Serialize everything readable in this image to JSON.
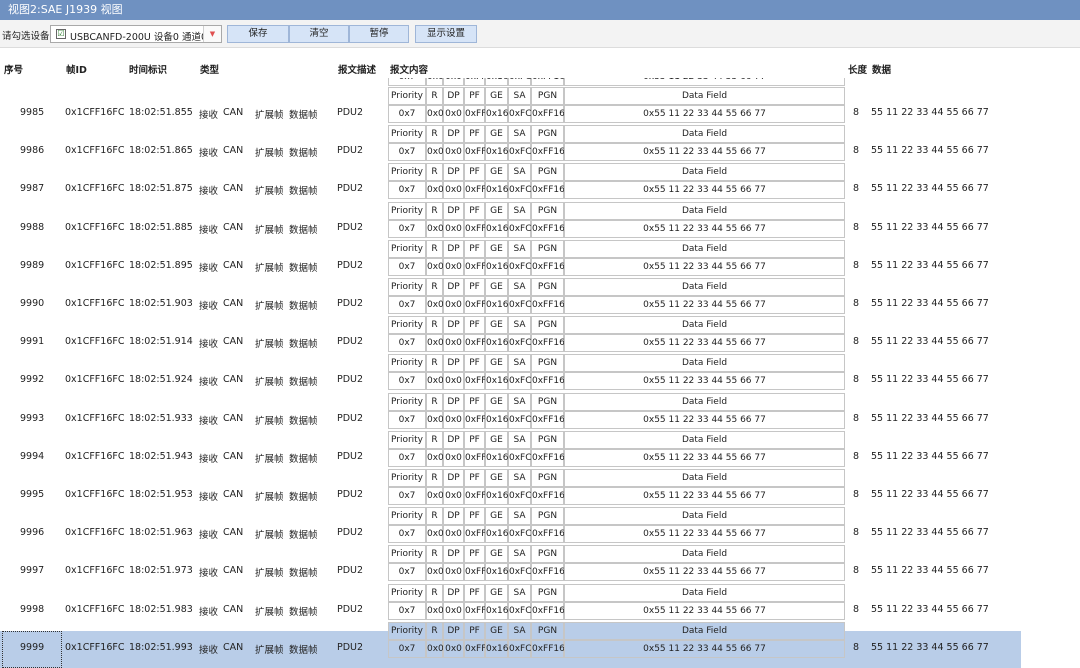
{
  "window": {
    "title": "视图2:SAE J1939 视图"
  },
  "toolbar": {
    "device_label": "请勾选设备",
    "device_checked": "☑",
    "device_value": "USBCANFD-200U 设备0 通道0",
    "dropdown_icon": "▼",
    "save_label": "保存",
    "clear_label": "清空",
    "pause_label": "暂停",
    "display_settings_label": "显示设置"
  },
  "columns": {
    "seq": "序号",
    "frame_id": "帧ID",
    "timestamp": "时间标识",
    "type": "类型",
    "desc": "报文描述",
    "content": "报文内容",
    "length": "长度",
    "data": "数据"
  },
  "j1939_headers": [
    "Priority",
    "R",
    "DP",
    "PF",
    "GE",
    "SA",
    "PGN",
    "Data Field"
  ],
  "partial_row": [
    "0x7",
    "0x0",
    "0x0",
    "0xFF",
    "0x16",
    "0xFC",
    "0xFF16",
    "0x55 11 22 33 44 55 66 77"
  ],
  "rows": [
    {
      "seq": "9985",
      "id": "0x1CFF16FC",
      "time": "18:02:51.855",
      "dir": "接收",
      "proto": "CAN",
      "ext": "扩展帧",
      "frame": "数据帧",
      "desc": "PDU2",
      "fields": [
        "0x7",
        "0x0",
        "0x0",
        "0xFF",
        "0x16",
        "0xFC",
        "0xFF16",
        "0x55 11 22 33 44 55 66 77"
      ],
      "len": "8",
      "data": "55 11 22 33 44 55 66 77"
    },
    {
      "seq": "9986",
      "id": "0x1CFF16FC",
      "time": "18:02:51.865",
      "dir": "接收",
      "proto": "CAN",
      "ext": "扩展帧",
      "frame": "数据帧",
      "desc": "PDU2",
      "fields": [
        "0x7",
        "0x0",
        "0x0",
        "0xFF",
        "0x16",
        "0xFC",
        "0xFF16",
        "0x55 11 22 33 44 55 66 77"
      ],
      "len": "8",
      "data": "55 11 22 33 44 55 66 77"
    },
    {
      "seq": "9987",
      "id": "0x1CFF16FC",
      "time": "18:02:51.875",
      "dir": "接收",
      "proto": "CAN",
      "ext": "扩展帧",
      "frame": "数据帧",
      "desc": "PDU2",
      "fields": [
        "0x7",
        "0x0",
        "0x0",
        "0xFF",
        "0x16",
        "0xFC",
        "0xFF16",
        "0x55 11 22 33 44 55 66 77"
      ],
      "len": "8",
      "data": "55 11 22 33 44 55 66 77"
    },
    {
      "seq": "9988",
      "id": "0x1CFF16FC",
      "time": "18:02:51.885",
      "dir": "接收",
      "proto": "CAN",
      "ext": "扩展帧",
      "frame": "数据帧",
      "desc": "PDU2",
      "fields": [
        "0x7",
        "0x0",
        "0x0",
        "0xFF",
        "0x16",
        "0xFC",
        "0xFF16",
        "0x55 11 22 33 44 55 66 77"
      ],
      "len": "8",
      "data": "55 11 22 33 44 55 66 77"
    },
    {
      "seq": "9989",
      "id": "0x1CFF16FC",
      "time": "18:02:51.895",
      "dir": "接收",
      "proto": "CAN",
      "ext": "扩展帧",
      "frame": "数据帧",
      "desc": "PDU2",
      "fields": [
        "0x7",
        "0x0",
        "0x0",
        "0xFF",
        "0x16",
        "0xFC",
        "0xFF16",
        "0x55 11 22 33 44 55 66 77"
      ],
      "len": "8",
      "data": "55 11 22 33 44 55 66 77"
    },
    {
      "seq": "9990",
      "id": "0x1CFF16FC",
      "time": "18:02:51.903",
      "dir": "接收",
      "proto": "CAN",
      "ext": "扩展帧",
      "frame": "数据帧",
      "desc": "PDU2",
      "fields": [
        "0x7",
        "0x0",
        "0x0",
        "0xFF",
        "0x16",
        "0xFC",
        "0xFF16",
        "0x55 11 22 33 44 55 66 77"
      ],
      "len": "8",
      "data": "55 11 22 33 44 55 66 77"
    },
    {
      "seq": "9991",
      "id": "0x1CFF16FC",
      "time": "18:02:51.914",
      "dir": "接收",
      "proto": "CAN",
      "ext": "扩展帧",
      "frame": "数据帧",
      "desc": "PDU2",
      "fields": [
        "0x7",
        "0x0",
        "0x0",
        "0xFF",
        "0x16",
        "0xFC",
        "0xFF16",
        "0x55 11 22 33 44 55 66 77"
      ],
      "len": "8",
      "data": "55 11 22 33 44 55 66 77"
    },
    {
      "seq": "9992",
      "id": "0x1CFF16FC",
      "time": "18:02:51.924",
      "dir": "接收",
      "proto": "CAN",
      "ext": "扩展帧",
      "frame": "数据帧",
      "desc": "PDU2",
      "fields": [
        "0x7",
        "0x0",
        "0x0",
        "0xFF",
        "0x16",
        "0xFC",
        "0xFF16",
        "0x55 11 22 33 44 55 66 77"
      ],
      "len": "8",
      "data": "55 11 22 33 44 55 66 77"
    },
    {
      "seq": "9993",
      "id": "0x1CFF16FC",
      "time": "18:02:51.933",
      "dir": "接收",
      "proto": "CAN",
      "ext": "扩展帧",
      "frame": "数据帧",
      "desc": "PDU2",
      "fields": [
        "0x7",
        "0x0",
        "0x0",
        "0xFF",
        "0x16",
        "0xFC",
        "0xFF16",
        "0x55 11 22 33 44 55 66 77"
      ],
      "len": "8",
      "data": "55 11 22 33 44 55 66 77"
    },
    {
      "seq": "9994",
      "id": "0x1CFF16FC",
      "time": "18:02:51.943",
      "dir": "接收",
      "proto": "CAN",
      "ext": "扩展帧",
      "frame": "数据帧",
      "desc": "PDU2",
      "fields": [
        "0x7",
        "0x0",
        "0x0",
        "0xFF",
        "0x16",
        "0xFC",
        "0xFF16",
        "0x55 11 22 33 44 55 66 77"
      ],
      "len": "8",
      "data": "55 11 22 33 44 55 66 77"
    },
    {
      "seq": "9995",
      "id": "0x1CFF16FC",
      "time": "18:02:51.953",
      "dir": "接收",
      "proto": "CAN",
      "ext": "扩展帧",
      "frame": "数据帧",
      "desc": "PDU2",
      "fields": [
        "0x7",
        "0x0",
        "0x0",
        "0xFF",
        "0x16",
        "0xFC",
        "0xFF16",
        "0x55 11 22 33 44 55 66 77"
      ],
      "len": "8",
      "data": "55 11 22 33 44 55 66 77"
    },
    {
      "seq": "9996",
      "id": "0x1CFF16FC",
      "time": "18:02:51.963",
      "dir": "接收",
      "proto": "CAN",
      "ext": "扩展帧",
      "frame": "数据帧",
      "desc": "PDU2",
      "fields": [
        "0x7",
        "0x0",
        "0x0",
        "0xFF",
        "0x16",
        "0xFC",
        "0xFF16",
        "0x55 11 22 33 44 55 66 77"
      ],
      "len": "8",
      "data": "55 11 22 33 44 55 66 77"
    },
    {
      "seq": "9997",
      "id": "0x1CFF16FC",
      "time": "18:02:51.973",
      "dir": "接收",
      "proto": "CAN",
      "ext": "扩展帧",
      "frame": "数据帧",
      "desc": "PDU2",
      "fields": [
        "0x7",
        "0x0",
        "0x0",
        "0xFF",
        "0x16",
        "0xFC",
        "0xFF16",
        "0x55 11 22 33 44 55 66 77"
      ],
      "len": "8",
      "data": "55 11 22 33 44 55 66 77"
    },
    {
      "seq": "9998",
      "id": "0x1CFF16FC",
      "time": "18:02:51.983",
      "dir": "接收",
      "proto": "CAN",
      "ext": "扩展帧",
      "frame": "数据帧",
      "desc": "PDU2",
      "fields": [
        "0x7",
        "0x0",
        "0x0",
        "0xFF",
        "0x16",
        "0xFC",
        "0xFF16",
        "0x55 11 22 33 44 55 66 77"
      ],
      "len": "8",
      "data": "55 11 22 33 44 55 66 77"
    },
    {
      "seq": "9999",
      "id": "0x1CFF16FC",
      "time": "18:02:51.993",
      "dir": "接收",
      "proto": "CAN",
      "ext": "扩展帧",
      "frame": "数据帧",
      "desc": "PDU2",
      "fields": [
        "0x7",
        "0x0",
        "0x0",
        "0xFF",
        "0x16",
        "0xFC",
        "0xFF16",
        "0x55 11 22 33 44 55 66 77"
      ],
      "len": "8",
      "data": "55 11 22 33 44 55 66 77",
      "selected": true
    }
  ],
  "colors": {
    "titlebar": "#6f91c1",
    "button": "#d6e4f7",
    "selection": "#b9cde8"
  }
}
